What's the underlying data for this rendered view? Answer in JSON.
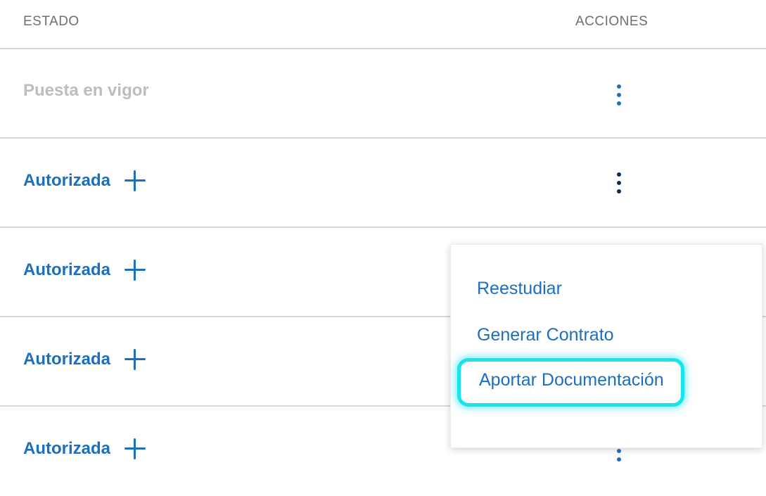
{
  "table": {
    "headers": {
      "estado": "ESTADO",
      "acciones": "ACCIONES"
    },
    "rows": [
      {
        "status": "Puesta en vigor",
        "status_state": "disabled",
        "has_plus": false
      },
      {
        "status": "Autorizada",
        "status_state": "active",
        "has_plus": true
      },
      {
        "status": "Autorizada",
        "status_state": "active",
        "has_plus": true
      },
      {
        "status": "Autorizada",
        "status_state": "active",
        "has_plus": true
      },
      {
        "status": "Autorizada",
        "status_state": "active",
        "has_plus": true
      }
    ]
  },
  "actions_menu": {
    "items": [
      {
        "label": "Reestudiar"
      },
      {
        "label": "Generar Contrato"
      },
      {
        "label": "Aportar Documentación",
        "highlighted": true
      }
    ]
  },
  "icons": {
    "row_actions": "kebab-menu-icon",
    "expand": "plus-icon"
  },
  "colors": {
    "accent": "#1b6fc0",
    "disabled_text": "#bdbdbd",
    "header_text": "#6f6f6f",
    "highlight_outline": "#18e3ee"
  }
}
